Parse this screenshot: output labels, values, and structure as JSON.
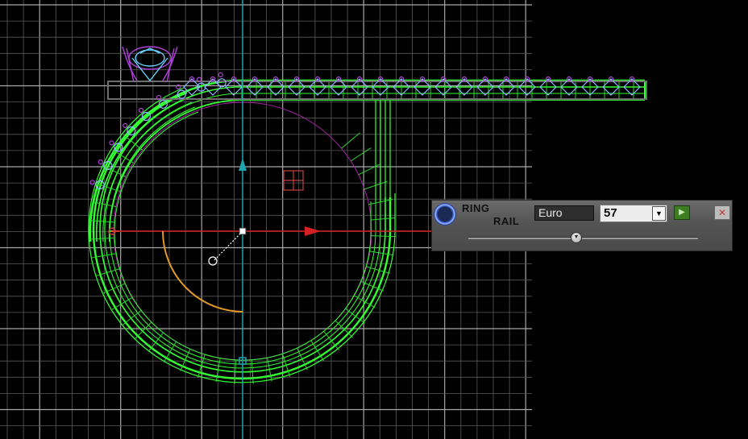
{
  "panel": {
    "title_line1": "RING",
    "title_line2": "RAIL",
    "name_value": "Euro",
    "size_value": "57",
    "slider_value": 0.47
  },
  "icons": {
    "logo": "ring-icon",
    "dropdown": "chevron-down-icon",
    "play": "play-icon",
    "close": "close-icon"
  },
  "colors": {
    "background": "#000000",
    "grid": "#8a8a8a",
    "ring_wire": "#33ff33",
    "y_axis": "#1fa3b0",
    "x_axis": "#d42020",
    "arc": "#e39a28",
    "stones": "#b040d8",
    "circle_guide": "#a020a0"
  }
}
